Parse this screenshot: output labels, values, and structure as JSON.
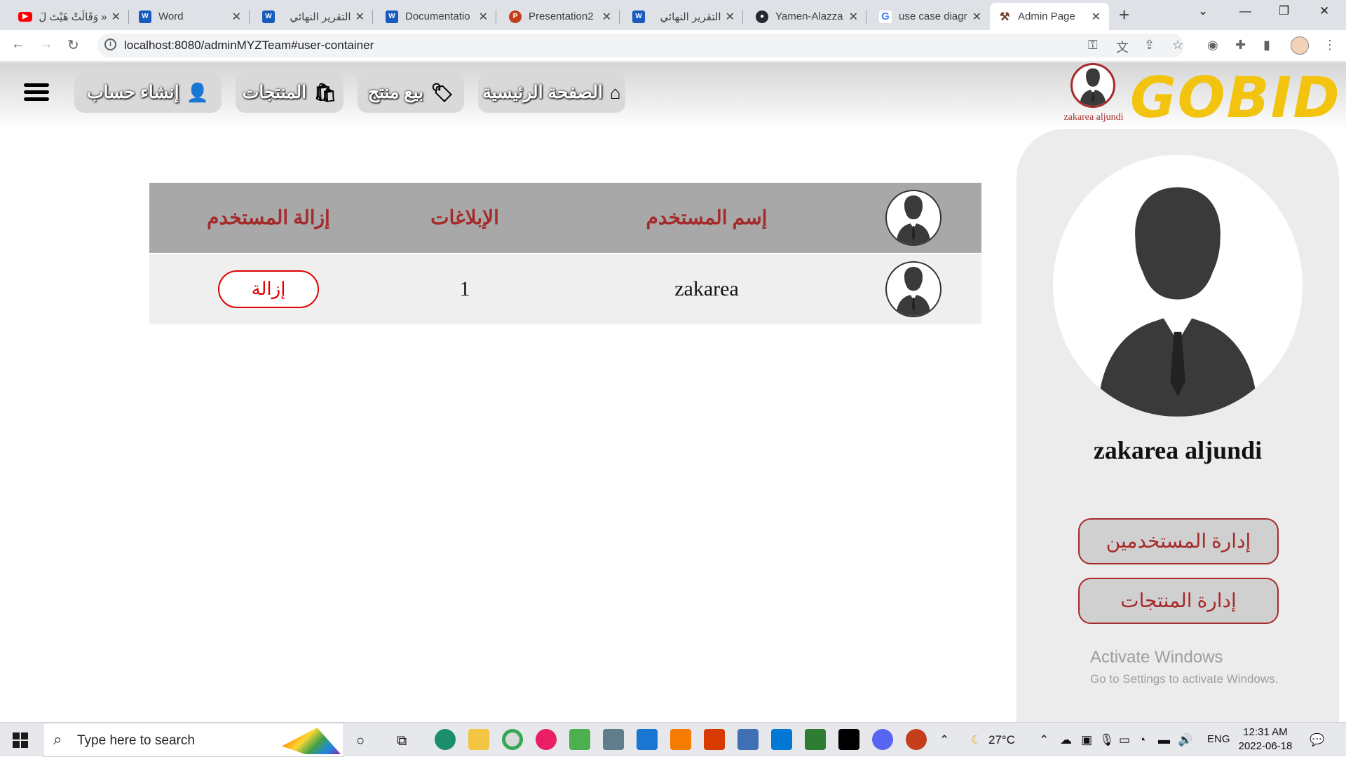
{
  "browser": {
    "tabs": [
      {
        "label": "« وَقَالَتْ هَيْتَ لَ",
        "icon": "youtube-icon"
      },
      {
        "label": "Word",
        "icon": "word-icon"
      },
      {
        "label": "التقرير النهائي",
        "icon": "word-icon"
      },
      {
        "label": "Documentatio",
        "icon": "word-icon"
      },
      {
        "label": "Presentation2",
        "icon": "powerpoint-icon"
      },
      {
        "label": "التقرير النهائي",
        "icon": "word-icon"
      },
      {
        "label": "Yamen-Alazza",
        "icon": "github-icon"
      },
      {
        "label": "use case diagr",
        "icon": "google-icon"
      },
      {
        "label": "Admin Page",
        "icon": "gavel-icon"
      }
    ],
    "url": "localhost:8080/adminMYZTeam#user-container"
  },
  "header": {
    "nav": {
      "home": "الصفحة الرئيسية",
      "sell": "بيع منتج",
      "products": "المنتجات",
      "create_account": "إنشاء حساب"
    },
    "logo": "GOBID",
    "username": "zakarea aljundi"
  },
  "table": {
    "columns": [
      "إسم المستخدم",
      "الإبلاغات",
      "إزالة المستخدم"
    ],
    "rows": [
      {
        "username": "zakarea",
        "reports": "1",
        "action": "إزالة"
      }
    ]
  },
  "side_panel": {
    "name": "zakarea aljundi",
    "manage_users": "إدارة المستخدمين",
    "manage_products": "إدارة المنتجات",
    "watermark_title": "Activate Windows",
    "watermark_sub": "Go to Settings to activate Windows."
  },
  "taskbar": {
    "search_placeholder": "Type here to search",
    "weather": "27°C",
    "language": "ENG",
    "time": "12:31 AM",
    "date": "2022-06-18"
  },
  "colors": {
    "accent": "#a52a2a",
    "logo": "#f2c40f",
    "danger": "#e00000",
    "table_header": "#a8a8a8"
  }
}
